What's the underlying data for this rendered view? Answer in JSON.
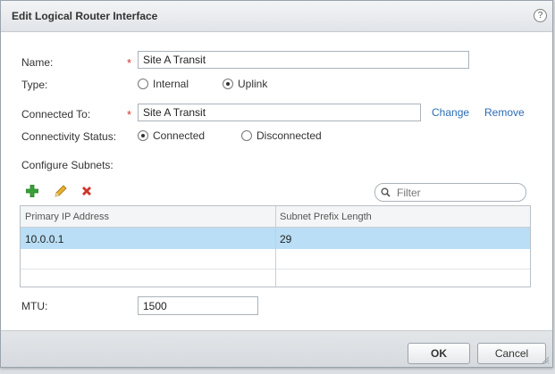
{
  "dialog": {
    "title": "Edit Logical Router Interface",
    "help_glyph": "?"
  },
  "form": {
    "name_label": "Name:",
    "name_value": "Site A Transit",
    "type_label": "Type:",
    "type_options": [
      "Internal",
      "Uplink"
    ],
    "type_selected": "Uplink",
    "connected_to_label": "Connected To:",
    "connected_to_value": "Site A Transit",
    "change_link": "Change",
    "remove_link": "Remove",
    "connectivity_label": "Connectivity Status:",
    "connectivity_options": [
      "Connected",
      "Disconnected"
    ],
    "connectivity_selected": "Connected",
    "subnets_label": "Configure Subnets:",
    "required_mark": "*"
  },
  "subnet_toolbar": {
    "add_icon": "add-icon",
    "edit_icon": "edit-icon",
    "delete_icon": "delete-icon",
    "filter_placeholder": "Filter"
  },
  "subnet_grid": {
    "columns": [
      "Primary IP Address",
      "Subnet Prefix Length"
    ],
    "rows": [
      {
        "ip": "10.0.0.1",
        "prefix": "29",
        "selected": true
      }
    ]
  },
  "mtu": {
    "label": "MTU:",
    "value": "1500"
  },
  "buttons": {
    "ok": "OK",
    "cancel": "Cancel"
  },
  "colors": {
    "required": "#d0342c",
    "link": "#2a6db5",
    "selected_row": "#b9def5",
    "add_icon": "#3aa13a",
    "delete_icon": "#d0342c",
    "edit_icon": "#e0a020"
  }
}
